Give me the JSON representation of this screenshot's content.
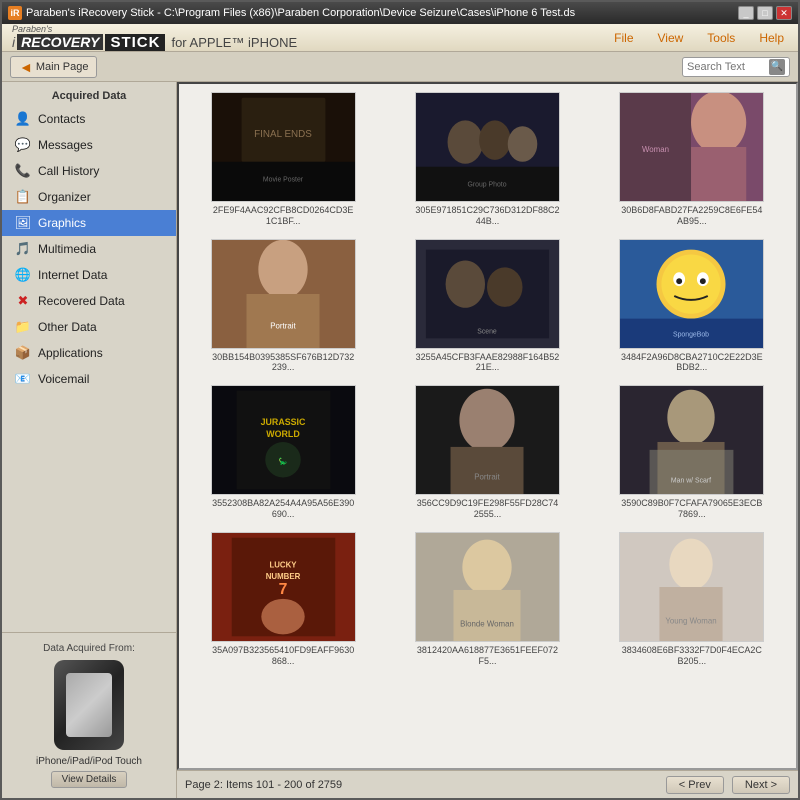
{
  "window": {
    "title": "Paraben's iRecovery Stick - C:\\Program Files (x86)\\Paraben Corporation\\Device Seizure\\Cases\\iPhone 6 Test.ds",
    "title_short": "Paraben's iRecovery Stick"
  },
  "header": {
    "brand_paraben": "Paraben's",
    "brand_irecovery": "iRECOVERY",
    "brand_stick": "STICK",
    "brand_subtitle": " for APPLE™ iPHONE",
    "menu_items": [
      "File",
      "View",
      "Tools",
      "Help"
    ]
  },
  "toolbar": {
    "back_label": "Main Page",
    "search_placeholder": "Search Text"
  },
  "sidebar": {
    "section_title": "Acquired Data",
    "items": [
      {
        "id": "contacts",
        "label": "Contacts",
        "icon": "👤"
      },
      {
        "id": "messages",
        "label": "Messages",
        "icon": "💬"
      },
      {
        "id": "call-history",
        "label": "Call History",
        "icon": "📞"
      },
      {
        "id": "organizer",
        "label": "Organizer",
        "icon": "📋"
      },
      {
        "id": "graphics",
        "label": "Graphics",
        "icon": "🖼",
        "active": true
      },
      {
        "id": "multimedia",
        "label": "Multimedia",
        "icon": "🎵"
      },
      {
        "id": "internet-data",
        "label": "Internet Data",
        "icon": "🌐"
      },
      {
        "id": "recovered-data",
        "label": "Recovered Data",
        "icon": "✖"
      },
      {
        "id": "other-data",
        "label": "Other Data",
        "icon": "📁"
      },
      {
        "id": "applications",
        "label": "Applications",
        "icon": "📦"
      },
      {
        "id": "voicemail",
        "label": "Voicemail",
        "icon": "📧"
      }
    ],
    "device_title": "Data Acquired From:",
    "device_label": "iPhone/iPad/iPod Touch",
    "view_details_label": "View Details"
  },
  "content": {
    "images": [
      {
        "filename": "2FE9F4AAC92CFB8CD0264CD3E1C1BF...",
        "bg": "#2a1a0e",
        "type": "movie_poster_dark"
      },
      {
        "filename": "305E971851C29C736D312DF88C244B...",
        "bg": "#1a1a2e",
        "type": "group_photo"
      },
      {
        "filename": "30B6D8FABD27FA2259C8E6FE54AB95...",
        "bg": "#6a3a5a",
        "type": "woman_purple"
      },
      {
        "filename": "30BB154B0395385SF676B12D732239...",
        "bg": "#8a6040",
        "type": "woman_portrait"
      },
      {
        "filename": "3255A45CFB3FAAE82988F164B5221E...",
        "bg": "#2a2a3a",
        "type": "movie_scene"
      },
      {
        "filename": "3484F2A96D8CBA2710C2E22D3EBDB2...",
        "bg": "#1a4a8a",
        "type": "spongebob"
      },
      {
        "filename": "3552308BA82A254A4A95A56E390690...",
        "bg": "#0a0a1a",
        "type": "jurassic_world"
      },
      {
        "filename": "356CC9D9C19FE298F55FD28C742555...",
        "bg": "#1a1a1a",
        "type": "man_portrait"
      },
      {
        "filename": "3590C89B0F7CFAFA79065E3ECB7869...",
        "bg": "#2a2a2a",
        "type": "man_scarf"
      },
      {
        "filename": "35A097B323565410FD9EAFF9630868...",
        "bg": "#8a2a1a",
        "type": "movie_poster_red"
      },
      {
        "filename": "3812420AA618877E3651FEEF072F5...",
        "bg": "#8a7a6a",
        "type": "woman_blonde"
      },
      {
        "filename": "3834608E6BF3332F7D0F4ECA2CB205...",
        "bg": "#c8c0b8",
        "type": "woman_young"
      }
    ]
  },
  "statusbar": {
    "page_info": "Page 2: Items 101 - 200 of 2759",
    "prev_label": "< Prev",
    "next_label": "Next >"
  }
}
